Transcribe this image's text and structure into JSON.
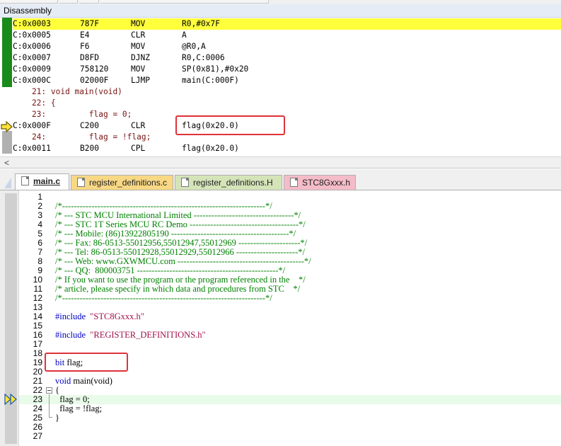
{
  "disassembly": {
    "title": "Disassembly",
    "lines": [
      {
        "addr": "C:0x0003",
        "hex": "787F",
        "mnemonic": "MOV",
        "operand": "R0,#0x7F",
        "highlight": true
      },
      {
        "addr": "C:0x0005",
        "hex": "E4",
        "mnemonic": "CLR",
        "operand": "A"
      },
      {
        "addr": "C:0x0006",
        "hex": "F6",
        "mnemonic": "MOV",
        "operand": "@R0,A"
      },
      {
        "addr": "C:0x0007",
        "hex": "D8FD",
        "mnemonic": "DJNZ",
        "operand": "R0,C:0006"
      },
      {
        "addr": "C:0x0009",
        "hex": "758120",
        "mnemonic": "MOV",
        "operand": "SP(0x81),#0x20"
      },
      {
        "addr": "C:0x000C",
        "hex": "02000F",
        "mnemonic": "LJMP",
        "operand": "main(C:000F)"
      },
      {
        "source": "    21: void main(void)"
      },
      {
        "source": "    22: {"
      },
      {
        "source": "    23:         flag = 0;"
      },
      {
        "addr": "C:0x000F",
        "hex": "C200",
        "mnemonic": "CLR",
        "operand": "flag(0x20.0)",
        "current": true
      },
      {
        "source": "    24:         flag = !flag;"
      },
      {
        "addr": "C:0x0011",
        "hex": "B200",
        "mnemonic": "CPL",
        "operand": "flag(0x20.0)"
      }
    ],
    "scroll_left": "<"
  },
  "tabs": [
    {
      "label": "main.c",
      "active": true
    },
    {
      "label": "register_definitions.c"
    },
    {
      "label": "register_definitions.H"
    },
    {
      "label": "STC8Gxxx.h"
    }
  ],
  "editor": {
    "lines": [
      {
        "n": "1",
        "text": ""
      },
      {
        "n": "2",
        "text": "/*---------------------------------------------------------------------*/",
        "kind": "comment"
      },
      {
        "n": "3",
        "text": "/* --- STC MCU International Limited ----------------------------------*/",
        "kind": "comment"
      },
      {
        "n": "4",
        "text": "/* --- STC 1T Series MCU RC Demo -------------------------------------*/",
        "kind": "comment"
      },
      {
        "n": "5",
        "text": "/* --- Mobile: (86)13922805190 ----------------------------------------*/",
        "kind": "comment"
      },
      {
        "n": "6",
        "text": "/* --- Fax: 86-0513-55012956,55012947,55012969 ---------------------*/",
        "kind": "comment"
      },
      {
        "n": "7",
        "text": "/* --- Tel: 86-0513-55012928,55012929,55012966 ---------------------*/",
        "kind": "comment"
      },
      {
        "n": "8",
        "text": "/* --- Web: www.GXWMCU.com -------------------------------------------*/",
        "kind": "comment"
      },
      {
        "n": "9",
        "text": "/* --- QQ:  800003751 ------------------------------------------------*/",
        "kind": "comment"
      },
      {
        "n": "10",
        "text": "/* If you want to use the program or the program referenced in the    */",
        "kind": "comment"
      },
      {
        "n": "11",
        "text": "/* article, please specify in which data and procedures from STC    */",
        "kind": "comment"
      },
      {
        "n": "12",
        "text": "/*---------------------------------------------------------------------*/",
        "kind": "comment"
      },
      {
        "n": "13",
        "text": ""
      },
      {
        "n": "14",
        "text": "#include  \"STC8Gxxx.h\"",
        "kind": "include"
      },
      {
        "n": "15",
        "text": ""
      },
      {
        "n": "16",
        "text": "#include  \"REGISTER_DEFINITIONS.h\"",
        "kind": "include"
      },
      {
        "n": "17",
        "text": ""
      },
      {
        "n": "18",
        "text": ""
      },
      {
        "n": "19",
        "text": "bit flag;",
        "kind": "plain"
      },
      {
        "n": "20",
        "text": ""
      },
      {
        "n": "21",
        "text": "void main(void)",
        "kind": "plain"
      },
      {
        "n": "22",
        "text": "{",
        "kind": "plain"
      },
      {
        "n": "23",
        "text": "  flag = 0;",
        "kind": "current"
      },
      {
        "n": "24",
        "text": "  flag = !flag;",
        "kind": "plain"
      },
      {
        "n": "25",
        "text": "}",
        "kind": "plain"
      },
      {
        "n": "26",
        "text": ""
      },
      {
        "n": "27",
        "text": ""
      }
    ]
  },
  "colors": {
    "highlight_yellow": "#ffff3c",
    "gutter_green": "#1a8a1a",
    "annotation_red": "#e0323a",
    "current_line_green": "#e9fbe9"
  }
}
